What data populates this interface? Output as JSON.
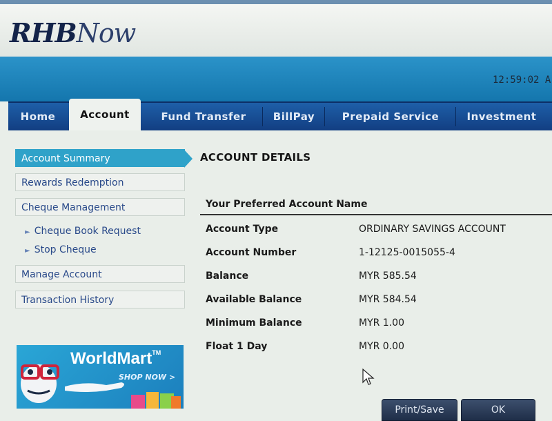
{
  "logo": {
    "part1": "RHB",
    "part2": "Now"
  },
  "header": {
    "clock": "12:59:02 A"
  },
  "tabs": [
    {
      "label": "Home"
    },
    {
      "label": "Account"
    },
    {
      "label": "Fund Transfer"
    },
    {
      "label": "BillPay"
    },
    {
      "label": "Prepaid Service"
    },
    {
      "label": "Investment"
    }
  ],
  "active_tab": "Account",
  "sidebar": {
    "items": [
      {
        "label": "Account Summary"
      },
      {
        "label": "Rewards Redemption"
      },
      {
        "label": "Cheque Management"
      },
      {
        "label": "Cheque Book Request"
      },
      {
        "label": "Stop Cheque"
      },
      {
        "label": "Manage Account"
      },
      {
        "label": "Transaction History"
      }
    ],
    "active": "Account Summary"
  },
  "promo": {
    "title": "WorldMart",
    "tm": "TM",
    "subtitle": "SHOP NOW >"
  },
  "main": {
    "title": "ACCOUNT DETAILS",
    "header": "Your Preferred Account Name",
    "rows": [
      {
        "label": "Account Type",
        "value": "ORDINARY SAVINGS ACCOUNT"
      },
      {
        "label": "Account Number",
        "value": "1-12125-0015055-4"
      },
      {
        "label": "Balance",
        "value": "MYR 585.54"
      },
      {
        "label": "Available Balance",
        "value": "MYR 584.54"
      },
      {
        "label": "Minimum Balance",
        "value": "MYR 1.00"
      },
      {
        "label": "Float 1 Day",
        "value": "MYR 0.00"
      }
    ]
  },
  "buttons": {
    "print_save": "Print/Save",
    "ok": "OK"
  },
  "colors": {
    "tab_bar": "#1e5fa8",
    "banner": "#2b93c9",
    "sidebar_active": "#2fa2c9",
    "link_text": "#2a4a8a"
  }
}
